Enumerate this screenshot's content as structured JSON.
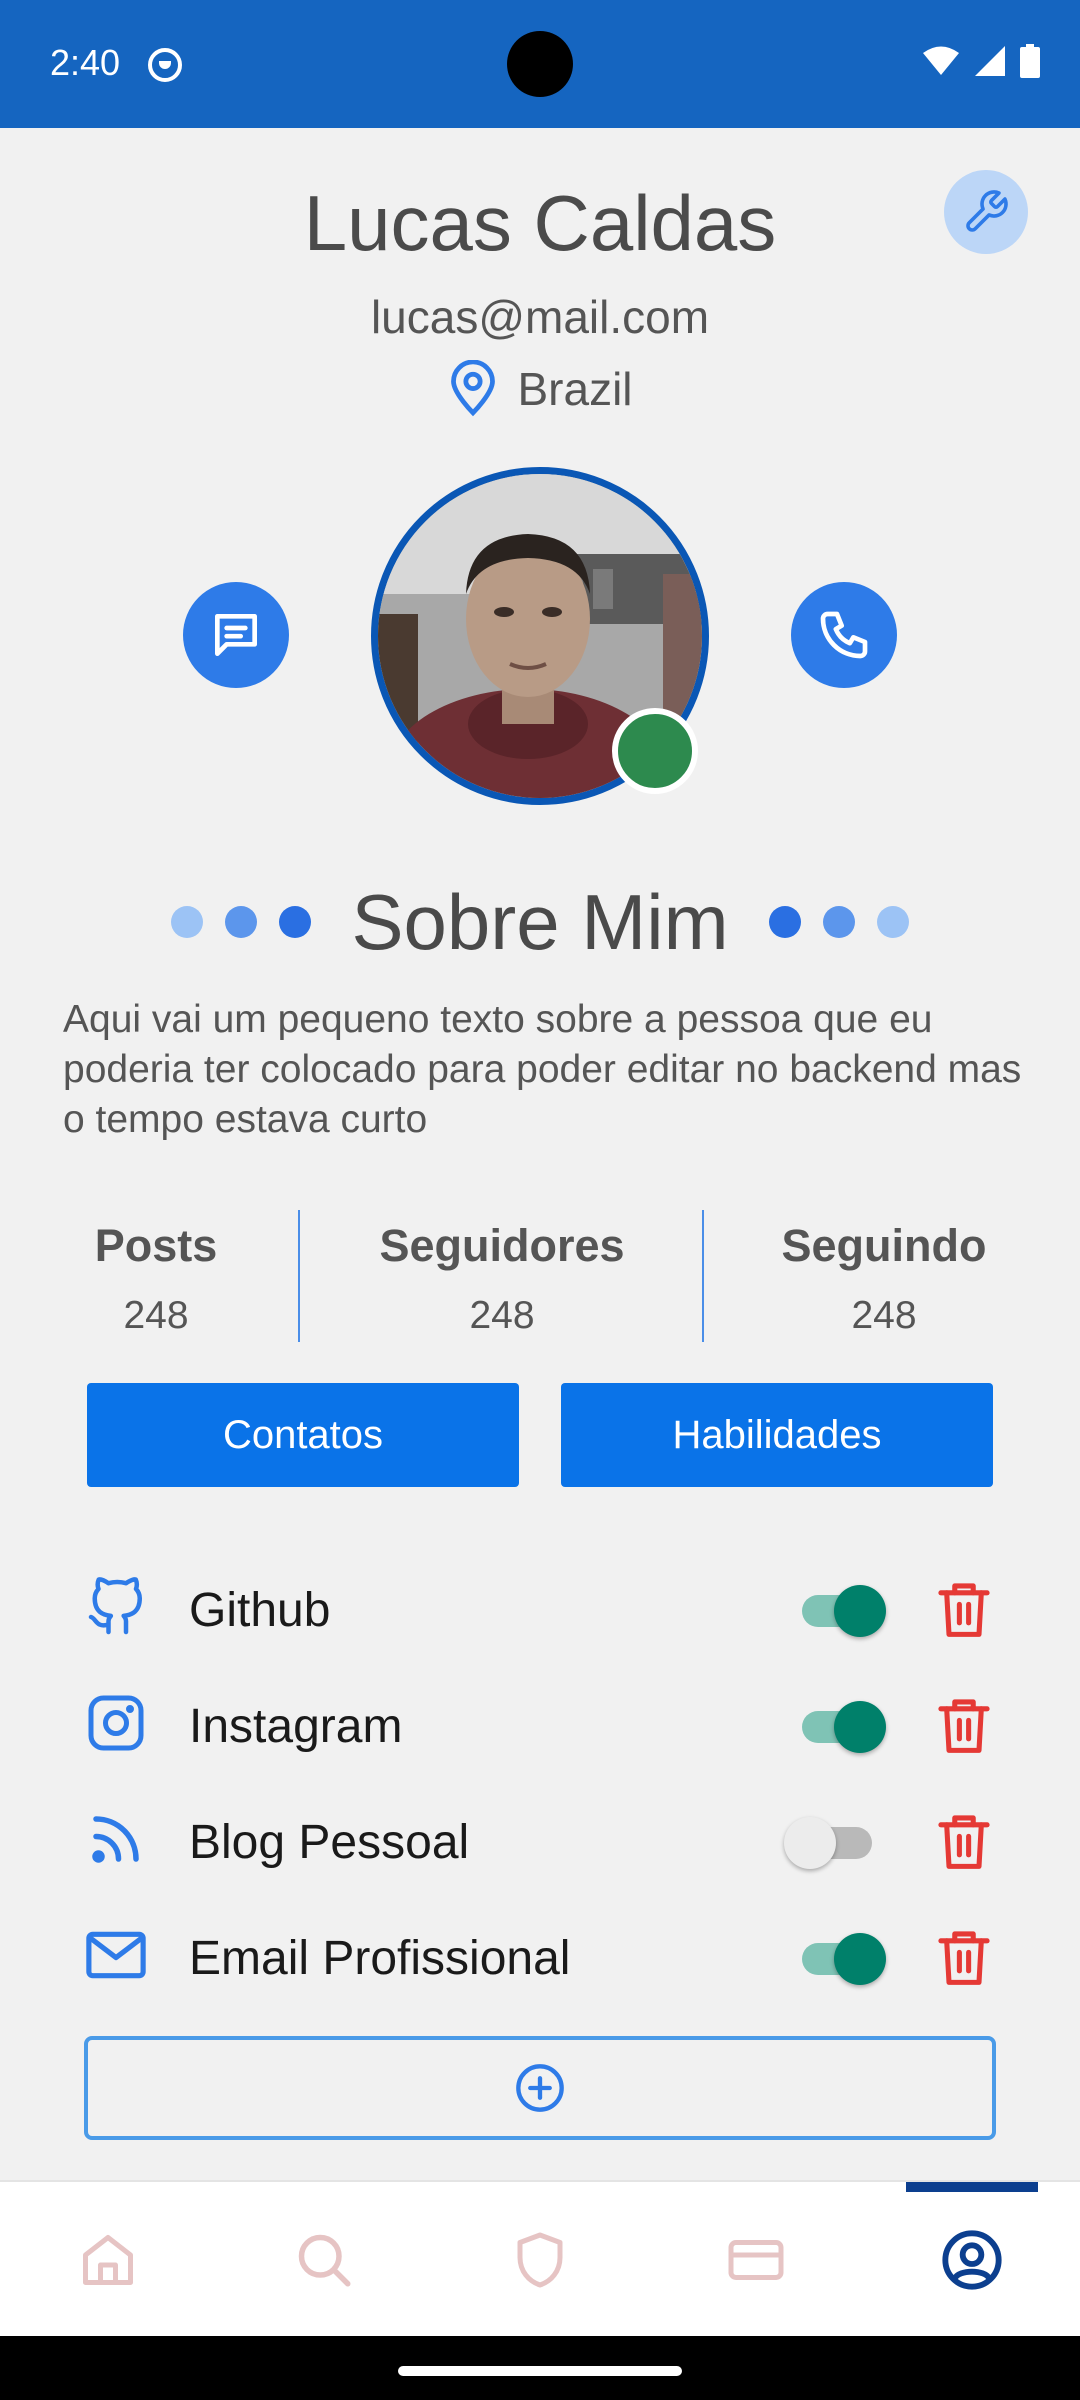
{
  "status_bar": {
    "time": "2:40"
  },
  "profile": {
    "name": "Lucas Caldas",
    "email": "lucas@mail.com",
    "location": "Brazil"
  },
  "about": {
    "title": "Sobre Mim",
    "text": "Aqui vai um pequeno texto sobre a pessoa que eu poderia ter colocado para poder editar no backend mas o tempo estava curto"
  },
  "stats": [
    {
      "label": "Posts",
      "value": "248"
    },
    {
      "label": "Seguidores",
      "value": "248"
    },
    {
      "label": "Seguindo",
      "value": "248"
    }
  ],
  "tabs": {
    "contacts": "Contatos",
    "skills": "Habilidades"
  },
  "contacts": [
    {
      "label": "Github",
      "icon": "github-icon",
      "enabled": true
    },
    {
      "label": "Instagram",
      "icon": "instagram-icon",
      "enabled": true
    },
    {
      "label": "Blog Pessoal",
      "icon": "rss-icon",
      "enabled": false
    },
    {
      "label": "Email Profissional",
      "icon": "mail-icon",
      "enabled": true
    }
  ],
  "bottom_nav": [
    "home-icon",
    "search-icon",
    "shield-icon",
    "card-icon",
    "profile-icon"
  ],
  "colors": {
    "primary": "#1565c0",
    "accent": "#0a73e8",
    "toggle_on": "#00806a",
    "delete": "#e53935",
    "online": "#2d8a4e"
  }
}
